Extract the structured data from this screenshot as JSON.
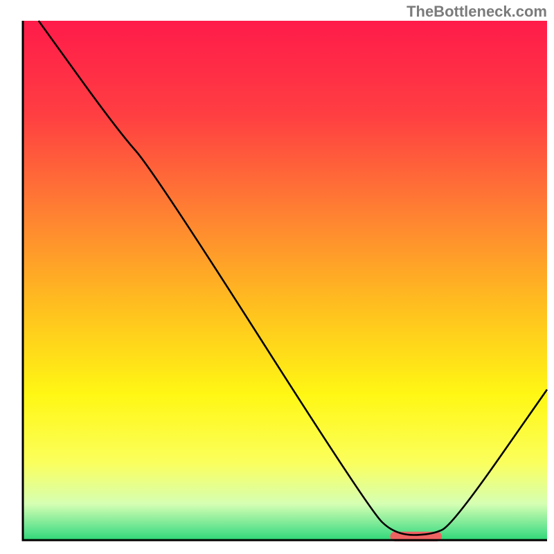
{
  "attribution": "TheBottleneck.com",
  "chart_data": {
    "type": "line",
    "title": "",
    "xlabel": "",
    "ylabel": "",
    "xlim": [
      0,
      100
    ],
    "ylim": [
      0,
      100
    ],
    "background_gradient_stops": [
      {
        "offset": 0.0,
        "color": "#ff1b4a"
      },
      {
        "offset": 0.18,
        "color": "#ff3e42"
      },
      {
        "offset": 0.36,
        "color": "#ff7d33"
      },
      {
        "offset": 0.55,
        "color": "#ffbf1f"
      },
      {
        "offset": 0.72,
        "color": "#fff714"
      },
      {
        "offset": 0.85,
        "color": "#fbff5c"
      },
      {
        "offset": 0.93,
        "color": "#d6ffb3"
      },
      {
        "offset": 0.985,
        "color": "#53e08a"
      },
      {
        "offset": 1.0,
        "color": "#2fd675"
      }
    ],
    "series": [
      {
        "name": "bottleneck-curve",
        "color": "#000000",
        "width": 2.6,
        "points": [
          {
            "x": 3,
            "y": 100
          },
          {
            "x": 18,
            "y": 79
          },
          {
            "x": 25,
            "y": 71
          },
          {
            "x": 66,
            "y": 6
          },
          {
            "x": 71,
            "y": 1
          },
          {
            "x": 78,
            "y": 1
          },
          {
            "x": 82,
            "y": 3
          },
          {
            "x": 100,
            "y": 29
          }
        ]
      }
    ],
    "marker": {
      "name": "optimal-range",
      "color": "#ef6262",
      "x_start": 71,
      "x_end": 79,
      "y": 0.7,
      "thickness": 14
    },
    "axes": {
      "color": "#000000",
      "width": 3
    }
  }
}
